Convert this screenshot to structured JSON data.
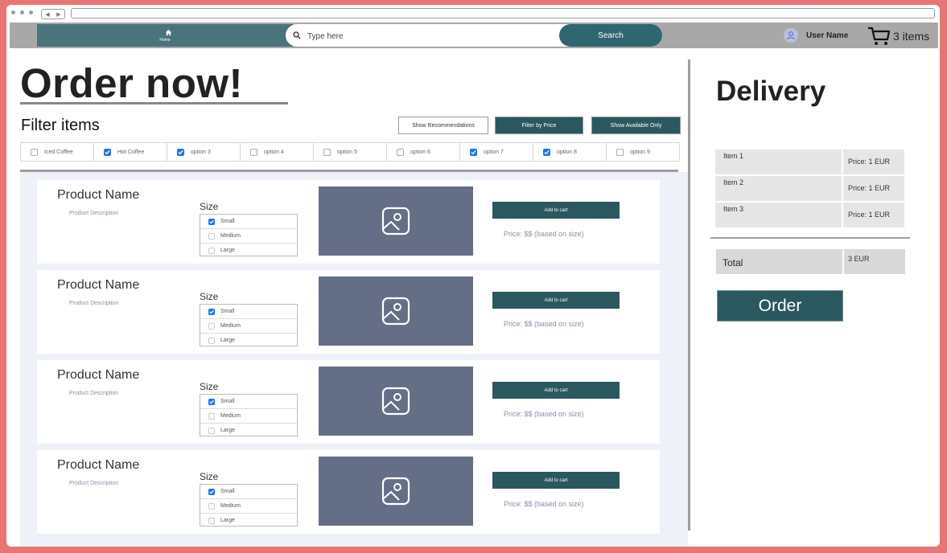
{
  "nav": {
    "home_label": "Home",
    "search_placeholder": "Type here",
    "search_button": "Search",
    "user_name": "User Name",
    "cart_count": "3 items"
  },
  "main": {
    "title": "Order now!",
    "filter_label": "Filter items",
    "filter_buttons": [
      "Show Recommendations",
      "Filter by Price",
      "Show Available Only"
    ],
    "options": [
      {
        "label": "Iced Coffee",
        "checked": false
      },
      {
        "label": "Hot Coffee",
        "checked": true
      },
      {
        "label": "option 3",
        "checked": true
      },
      {
        "label": "option 4",
        "checked": false
      },
      {
        "label": "option 5",
        "checked": false
      },
      {
        "label": "option 6",
        "checked": false
      },
      {
        "label": "option 7",
        "checked": true
      },
      {
        "label": "option 8",
        "checked": true
      },
      {
        "label": "option 9",
        "checked": false
      }
    ],
    "products": [
      {
        "name": "Product Name",
        "description": "Product Description",
        "size_label": "Size",
        "sizes": [
          {
            "label": "Small",
            "checked": true
          },
          {
            "label": "Medium",
            "checked": false
          },
          {
            "label": "Large",
            "checked": false
          }
        ],
        "add_label": "Add to cart",
        "price": "Price: $$ (based on size)"
      },
      {
        "name": "Product Name",
        "description": "Product Description",
        "size_label": "Size",
        "sizes": [
          {
            "label": "Small",
            "checked": true
          },
          {
            "label": "Medium",
            "checked": false
          },
          {
            "label": "Large",
            "checked": false
          }
        ],
        "add_label": "Add to cart",
        "price": "Price: $$ (based on size)"
      },
      {
        "name": "Product Name",
        "description": "Product Description",
        "size_label": "Size",
        "sizes": [
          {
            "label": "Small",
            "checked": true
          },
          {
            "label": "Medium",
            "checked": false
          },
          {
            "label": "Large",
            "checked": false
          }
        ],
        "add_label": "Add to cart",
        "price": "Price: $$ (based on size)"
      },
      {
        "name": "Product Name",
        "description": "Product Description",
        "size_label": "Size",
        "sizes": [
          {
            "label": "Small",
            "checked": true
          },
          {
            "label": "Medium",
            "checked": false
          },
          {
            "label": "Large",
            "checked": false
          }
        ],
        "add_label": "Add to cart",
        "price": "Price: $$ (based on size)"
      }
    ]
  },
  "delivery": {
    "title": "Delivery",
    "items": [
      {
        "name": "Item 1",
        "price": "Price: 1 EUR"
      },
      {
        "name": "Item 2",
        "price": "Price: 1 EUR"
      },
      {
        "name": "Item 3",
        "price": "Price: 1 EUR"
      }
    ],
    "total_label": "Total",
    "total_value": "3 EUR",
    "order_button": "Order"
  },
  "colors": {
    "background": "#e87474",
    "accent_dark": "#2b575f",
    "accent": "#4a747c",
    "checkbox": "#1877f2",
    "image_placeholder": "#656e87"
  },
  "icons": [
    "home-icon",
    "search-icon",
    "user-icon",
    "cart-icon",
    "image-placeholder-icon",
    "check-icon"
  ]
}
